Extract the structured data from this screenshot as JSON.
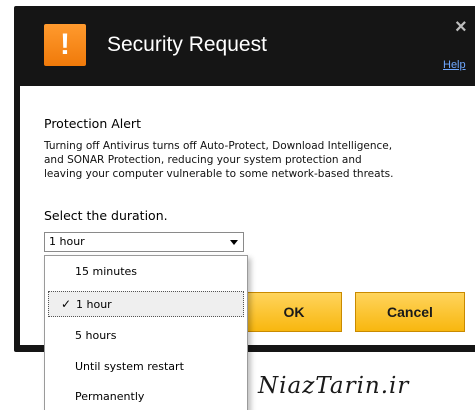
{
  "window": {
    "title": "Security Request",
    "alert_icon_glyph": "!",
    "close_glyph": "×",
    "help_link": "Help"
  },
  "alert": {
    "heading": "Protection Alert",
    "body_lines": [
      "Turning off Antivirus turns off Auto-Protect, Download Intelligence,",
      "and SONAR Protection, reducing your system protection and",
      "leaving your computer vulnerable to some network-based threats."
    ]
  },
  "duration": {
    "label": "Select the duration.",
    "selected_value": "1 hour",
    "options": [
      {
        "label": "15 minutes",
        "checked": false
      },
      {
        "label": "1 hour",
        "checked": true
      },
      {
        "label": "5 hours",
        "checked": false
      },
      {
        "label": "Until system restart",
        "checked": false
      },
      {
        "label": "Permanently",
        "checked": false
      }
    ],
    "check_glyph": "✓"
  },
  "buttons": {
    "ok": "OK",
    "cancel": "Cancel"
  },
  "watermark": "NiazTarin.ir",
  "colors": {
    "frame": "#151515",
    "accent_orange": "#f5881f",
    "button_yellow": "#fcc02c",
    "help_link": "#6fa8ff"
  },
  "icons": {
    "alert": "exclamation-icon",
    "close": "close-icon",
    "dropdown": "chevron-down-icon",
    "selected": "checkmark-icon"
  }
}
